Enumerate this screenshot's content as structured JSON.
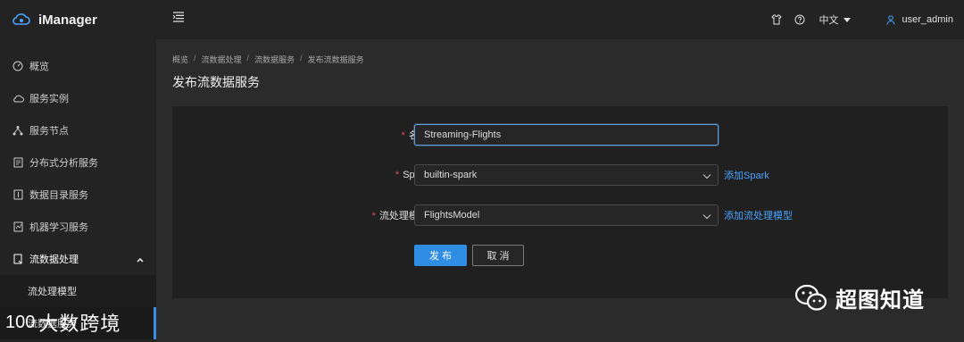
{
  "app": {
    "name": "iManager"
  },
  "sidebar": {
    "items": [
      {
        "label": "概览",
        "icon": "dashboard-icon"
      },
      {
        "label": "服务实例",
        "icon": "cloud-icon"
      },
      {
        "label": "服务节点",
        "icon": "nodes-icon"
      },
      {
        "label": "分布式分析服务",
        "icon": "document-icon"
      },
      {
        "label": "数据目录服务",
        "icon": "catalog-icon"
      },
      {
        "label": "机器学习服务",
        "icon": "ml-icon"
      },
      {
        "label": "流数据处理",
        "icon": "stream-icon",
        "expanded": true
      }
    ],
    "sub_items": [
      {
        "label": "流处理模型"
      },
      {
        "label": "流数据服务"
      }
    ]
  },
  "header": {
    "language": "中文",
    "user": "user_admin"
  },
  "breadcrumb": [
    "概览",
    "流数据处理",
    "流数据服务",
    "发布流数据服务"
  ],
  "page_title": "发布流数据服务",
  "form": {
    "name_label": "名称:",
    "name_value": "Streaming-Flights",
    "spark_label": "Spark:",
    "spark_value": "builtin-spark",
    "spark_link": "添加Spark",
    "model_label": "流处理模型:",
    "model_value": "FlightsModel",
    "model_link": "添加流处理模型",
    "required_mark": "*",
    "publish_label": "发 布",
    "cancel_label": "取 消"
  },
  "watermarks": {
    "right": "超图知道",
    "left_badge": "100",
    "left_text": "大数跨境"
  },
  "colors": {
    "accent": "#2f8de4",
    "link": "#4aa3ff",
    "required": "#e5484d",
    "background": "#2b2b2b",
    "panel": "#202020"
  }
}
